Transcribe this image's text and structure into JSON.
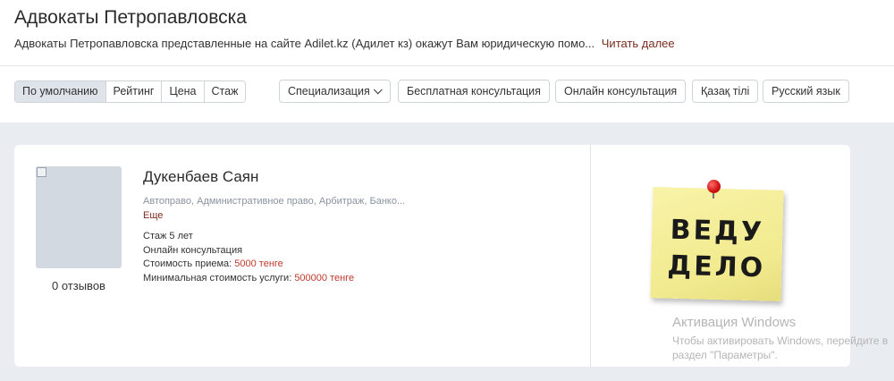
{
  "header": {
    "title": "Адвокаты Петропавловска",
    "intro": "Адвокаты Петропавловска представленные на сайте Adilet.kz (Адилет кз) окажут Вам юридическую помо...",
    "read_more": "Читать далее"
  },
  "sort": {
    "options": [
      "По умолчанию",
      "Рейтинг",
      "Цена",
      "Стаж"
    ],
    "active": "По умолчанию"
  },
  "filters": {
    "specialization": "Специализация",
    "free_consult": "Бесплатная консультация",
    "online_consult": "Онлайн консультация",
    "kazakh": "Қазақ тілі",
    "russian": "Русский язык"
  },
  "lawyer": {
    "name": "Дукенбаев Саян",
    "reviews": "0 отзывов",
    "specializations": "Автоправо, Административное право, Арбитраж, Банко...",
    "more": "Еще",
    "experience": "Стаж 5 лет",
    "online": "Онлайн консультация",
    "fee_label": "Стоимость приема: ",
    "fee_value": "5000 тенге",
    "min_fee_label": "Минимальная стоимость услуги: ",
    "min_fee_value": "500000 тенге"
  },
  "sticky_note": {
    "line1": "ВЕДУ",
    "line2": "ДЕЛО"
  },
  "watermark": {
    "title": "Активация Windows",
    "line1": "Чтобы активировать Windows, перейдите в",
    "line2": "раздел \"Параметры\"."
  },
  "colors": {
    "accent_link": "#7a2e1f",
    "price": "#c0392b",
    "page_bg": "#e9ecf0"
  }
}
